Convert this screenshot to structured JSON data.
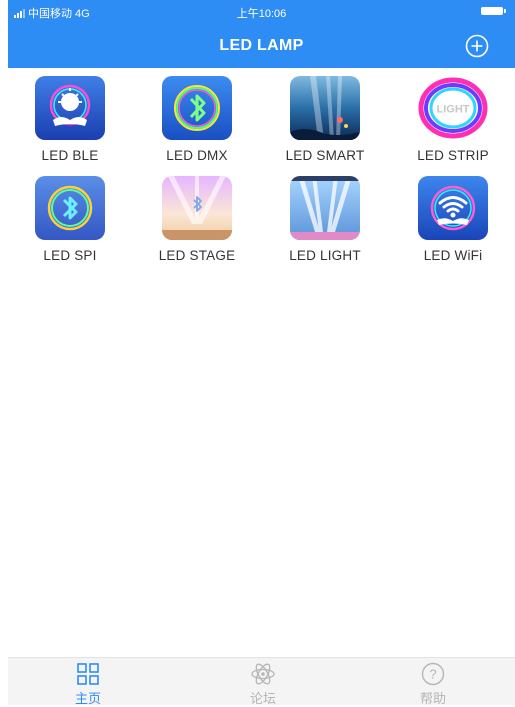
{
  "status_bar": {
    "carrier": "中国移动 4G",
    "time": "上午10:06"
  },
  "header": {
    "title": "LED LAMP",
    "add_icon": "plus-circle-icon",
    "background_color": "#2e8df4"
  },
  "apps": [
    {
      "label": "LED BLE",
      "icon": "led-ble-icon"
    },
    {
      "label": "LED DMX",
      "icon": "led-dmx-icon"
    },
    {
      "label": "LED SMART",
      "icon": "led-smart-icon"
    },
    {
      "label": "LED STRIP",
      "icon": "led-strip-icon",
      "icon_text": "LIGHT"
    },
    {
      "label": "LED SPI",
      "icon": "led-spi-icon"
    },
    {
      "label": "LED STAGE",
      "icon": "led-stage-icon"
    },
    {
      "label": "LED LIGHT",
      "icon": "led-light-icon"
    },
    {
      "label": "LED WiFi",
      "icon": "led-wifi-icon"
    }
  ],
  "tab_bar": {
    "tabs": [
      {
        "label": "主页",
        "icon": "grid-icon",
        "active": true
      },
      {
        "label": "论坛",
        "icon": "atom-icon",
        "active": false
      },
      {
        "label": "帮助",
        "icon": "question-icon",
        "active": false
      }
    ],
    "active_color": "#2e8df4",
    "inactive_color": "#b5b5b5"
  }
}
